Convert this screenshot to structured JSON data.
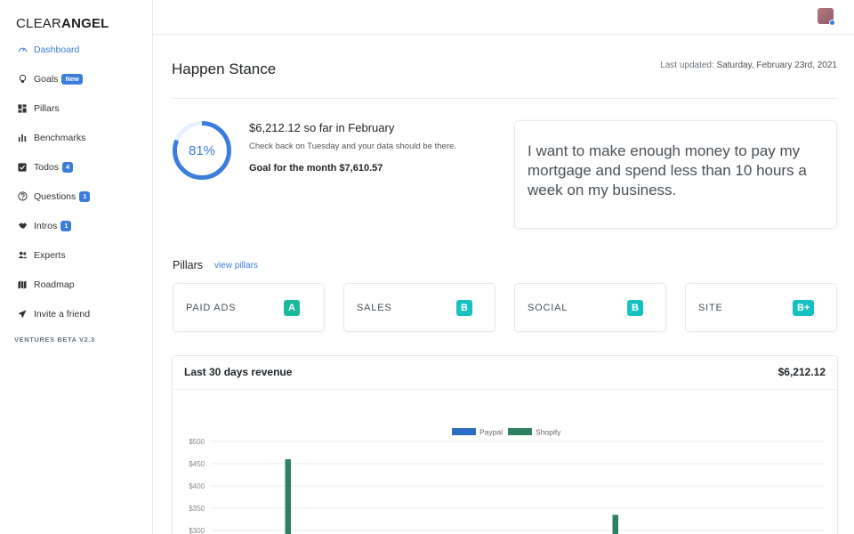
{
  "sidebar": {
    "logo_part1": "CLEAR",
    "logo_part2": "ANGEL",
    "items": [
      {
        "label": "Dashboard",
        "icon": "gauge-icon",
        "active": true
      },
      {
        "label": "Goals",
        "icon": "lightbulb-icon",
        "badge": "New"
      },
      {
        "label": "Pillars",
        "icon": "grid-icon"
      },
      {
        "label": "Benchmarks",
        "icon": "bar-chart-icon"
      },
      {
        "label": "Todos",
        "icon": "check-square-icon",
        "badge": "4"
      },
      {
        "label": "Questions",
        "icon": "question-circle-icon",
        "badge": "1"
      },
      {
        "label": "Intros",
        "icon": "handshake-icon",
        "badge": "1"
      },
      {
        "label": "Experts",
        "icon": "users-icon"
      },
      {
        "label": "Roadmap",
        "icon": "map-icon"
      },
      {
        "label": "Invite a friend",
        "icon": "send-icon"
      }
    ],
    "version": "VENTURES BETA V2.3"
  },
  "header": {
    "page_title": "Happen Stance",
    "last_updated_label": "Last updated:",
    "last_updated_date": "Saturday, February 23rd, 2021"
  },
  "progress": {
    "percent": 81,
    "percent_label": "81%",
    "headline": "$6,212.12 so far in February",
    "sub": "Check back on Tuesday and your data should be there.",
    "goal": "Goal for the month $7,610.57"
  },
  "goal_statement": "I want to make enough money to pay my mortgage and spend less than 10 hours a week on my business.",
  "pillars": {
    "title": "Pillars",
    "link": "view pillars",
    "items": [
      {
        "name": "PAID ADS",
        "grade": "A"
      },
      {
        "name": "SALES",
        "grade": "B"
      },
      {
        "name": "SOCIAL",
        "grade": "B"
      },
      {
        "name": "SITE",
        "grade": "B+"
      }
    ]
  },
  "revenue": {
    "title": "Last 30 days revenue",
    "total": "$6,212.12"
  },
  "colors": {
    "accent": "#3b7ddd",
    "paypal": "#2d6cc4",
    "shopify": "#2e8060",
    "grade": "#17c1c1",
    "grade_a": "#1ab99a"
  },
  "chart_data": {
    "type": "bar",
    "legend_position": "top-center",
    "series": [
      {
        "name": "Paypal",
        "values": []
      },
      {
        "name": "Shopify",
        "values": [
          {
            "index": 3,
            "value": 460
          },
          {
            "index": 19,
            "value": 335
          }
        ]
      }
    ],
    "y_ticks": [
      "$500",
      "$450",
      "$400",
      "$350",
      "$300"
    ],
    "ylim": [
      300,
      500
    ],
    "bar_slots": 30,
    "grid": true
  }
}
